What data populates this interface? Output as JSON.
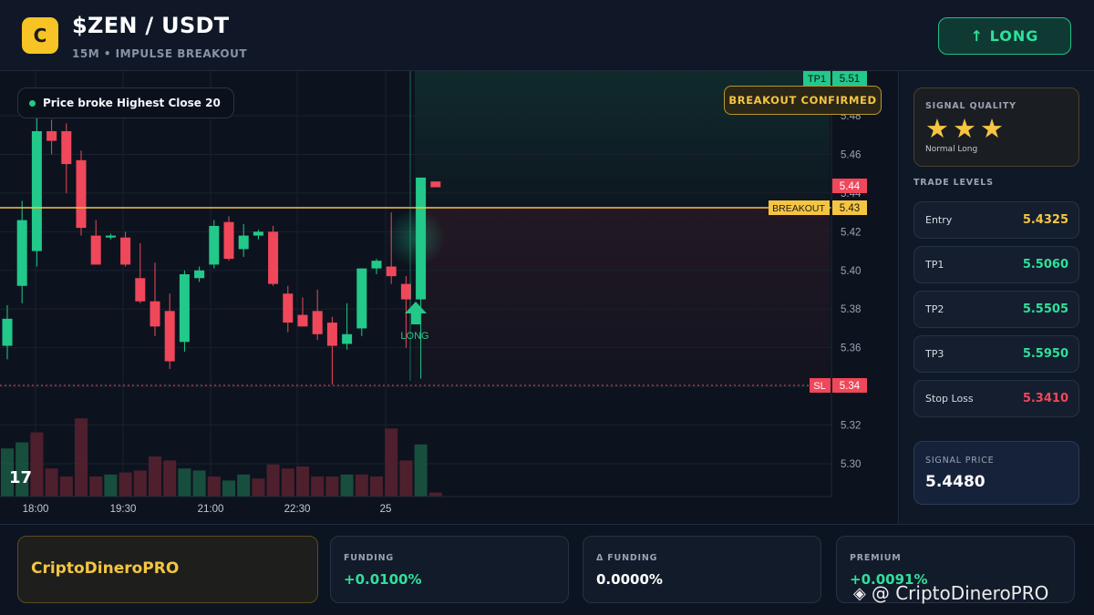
{
  "header": {
    "logo_letter": "C",
    "title": "$ZEN / USDT",
    "subtitle": "15M • IMPULSE BREAKOUT",
    "long_button": "↑ LONG"
  },
  "chart": {
    "info_pill": "Price broke Highest Close 20",
    "badge": "BREAKOUT CONFIRMED",
    "long_marker_label": "LONG",
    "tv_logo": "17",
    "level_tags": {
      "tp1_label": "TP1",
      "tp1_value": "5.51",
      "current_value": "5.44",
      "breakout_label": "BREAKOUT",
      "breakout_value": "5.43",
      "sl_label": "SL",
      "sl_value": "5.34"
    },
    "colors": {
      "up": "#22c98a",
      "down": "#f0475a",
      "breakout": "#f5c542"
    }
  },
  "chart_data": {
    "type": "candlestick",
    "title": "",
    "ylim": [
      5.28,
      5.51
    ],
    "y_ticks": [
      "5.48",
      "5.46",
      "5.44",
      "5.42",
      "5.40",
      "5.38",
      "5.36",
      "5.34",
      "5.32",
      "5.30"
    ],
    "x_ticks": [
      "18:00",
      "19:30",
      "21:00",
      "22:30",
      "25"
    ],
    "candles": [
      {
        "o": 5.361,
        "h": 5.382,
        "l": 5.354,
        "c": 5.375
      },
      {
        "o": 5.392,
        "h": 5.436,
        "l": 5.383,
        "c": 5.426
      },
      {
        "o": 5.41,
        "h": 5.482,
        "l": 5.402,
        "c": 5.472
      },
      {
        "o": 5.472,
        "h": 5.478,
        "l": 5.46,
        "c": 5.467
      },
      {
        "o": 5.472,
        "h": 5.476,
        "l": 5.44,
        "c": 5.455
      },
      {
        "o": 5.457,
        "h": 5.462,
        "l": 5.418,
        "c": 5.422
      },
      {
        "o": 5.418,
        "h": 5.426,
        "l": 5.404,
        "c": 5.403
      },
      {
        "o": 5.417,
        "h": 5.419,
        "l": 5.416,
        "c": 5.418
      },
      {
        "o": 5.417,
        "h": 5.42,
        "l": 5.402,
        "c": 5.403
      },
      {
        "o": 5.396,
        "h": 5.414,
        "l": 5.383,
        "c": 5.384
      },
      {
        "o": 5.384,
        "h": 5.404,
        "l": 5.366,
        "c": 5.371
      },
      {
        "o": 5.379,
        "h": 5.388,
        "l": 5.349,
        "c": 5.353
      },
      {
        "o": 5.363,
        "h": 5.4,
        "l": 5.358,
        "c": 5.398
      },
      {
        "o": 5.396,
        "h": 5.402,
        "l": 5.394,
        "c": 5.4
      },
      {
        "o": 5.403,
        "h": 5.426,
        "l": 5.401,
        "c": 5.423
      },
      {
        "o": 5.425,
        "h": 5.428,
        "l": 5.405,
        "c": 5.406
      },
      {
        "o": 5.411,
        "h": 5.424,
        "l": 5.407,
        "c": 5.418
      },
      {
        "o": 5.418,
        "h": 5.421,
        "l": 5.416,
        "c": 5.42
      },
      {
        "o": 5.42,
        "h": 5.423,
        "l": 5.392,
        "c": 5.393
      },
      {
        "o": 5.388,
        "h": 5.392,
        "l": 5.368,
        "c": 5.373
      },
      {
        "o": 5.377,
        "h": 5.386,
        "l": 5.371,
        "c": 5.371
      },
      {
        "o": 5.379,
        "h": 5.39,
        "l": 5.364,
        "c": 5.367
      },
      {
        "o": 5.373,
        "h": 5.376,
        "l": 5.341,
        "c": 5.361
      },
      {
        "o": 5.362,
        "h": 5.383,
        "l": 5.359,
        "c": 5.367
      },
      {
        "o": 5.37,
        "h": 5.401,
        "l": 5.366,
        "c": 5.401
      },
      {
        "o": 5.401,
        "h": 5.406,
        "l": 5.398,
        "c": 5.405
      },
      {
        "o": 5.402,
        "h": 5.43,
        "l": 5.393,
        "c": 5.397
      },
      {
        "o": 5.393,
        "h": 5.397,
        "l": 5.36,
        "c": 5.385
      },
      {
        "o": 5.385,
        "h": 5.448,
        "l": 5.344,
        "c": 5.448
      },
      {
        "o": 5.446,
        "h": 5.446,
        "l": 5.443,
        "c": 5.443
      }
    ],
    "volumes": [
      {
        "v": 24,
        "up": true
      },
      {
        "v": 27,
        "up": true
      },
      {
        "v": 32,
        "up": false
      },
      {
        "v": 14,
        "up": false
      },
      {
        "v": 10,
        "up": false
      },
      {
        "v": 39,
        "up": false
      },
      {
        "v": 10,
        "up": false
      },
      {
        "v": 11,
        "up": true
      },
      {
        "v": 12,
        "up": false
      },
      {
        "v": 13,
        "up": false
      },
      {
        "v": 20,
        "up": false
      },
      {
        "v": 18,
        "up": false
      },
      {
        "v": 14,
        "up": true
      },
      {
        "v": 13,
        "up": true
      },
      {
        "v": 10,
        "up": false
      },
      {
        "v": 8,
        "up": true
      },
      {
        "v": 11,
        "up": true
      },
      {
        "v": 9,
        "up": false
      },
      {
        "v": 16,
        "up": false
      },
      {
        "v": 14,
        "up": false
      },
      {
        "v": 15,
        "up": false
      },
      {
        "v": 10,
        "up": false
      },
      {
        "v": 10,
        "up": false
      },
      {
        "v": 11,
        "up": true
      },
      {
        "v": 11,
        "up": false
      },
      {
        "v": 10,
        "up": false
      },
      {
        "v": 34,
        "up": false
      },
      {
        "v": 18,
        "up": false
      },
      {
        "v": 26,
        "up": true
      },
      {
        "v": 2,
        "up": false
      }
    ]
  },
  "sidebar": {
    "signal_quality_title": "SIGNAL QUALITY",
    "stars": "★★★",
    "signal_quality_sub": "Normal Long",
    "trade_levels_title": "TRADE LEVELS",
    "levels": [
      {
        "label": "Entry",
        "value": "5.4325",
        "color": "#f5c542"
      },
      {
        "label": "TP1",
        "value": "5.5060",
        "color": "#2fe09a"
      },
      {
        "label": "TP2",
        "value": "5.5505",
        "color": "#2fe09a"
      },
      {
        "label": "TP3",
        "value": "5.5950",
        "color": "#2fe09a"
      },
      {
        "label": "Stop Loss",
        "value": "5.3410",
        "color": "#f0475a"
      }
    ],
    "signal_price_title": "SIGNAL PRICE",
    "signal_price": "5.4480"
  },
  "bottom": {
    "brand": "CriptoDineroPRO",
    "stats": [
      {
        "title": "FUNDING",
        "value": "+0.0100%",
        "color": "#2fe09a"
      },
      {
        "title": "Δ FUNDING",
        "value": "0.0000%",
        "color": "#ffffff"
      },
      {
        "title": "PREMIUM",
        "value": "+0.0091%",
        "color": "#2fe09a"
      }
    ],
    "watermark": "@ CriptoDineroPRO"
  }
}
